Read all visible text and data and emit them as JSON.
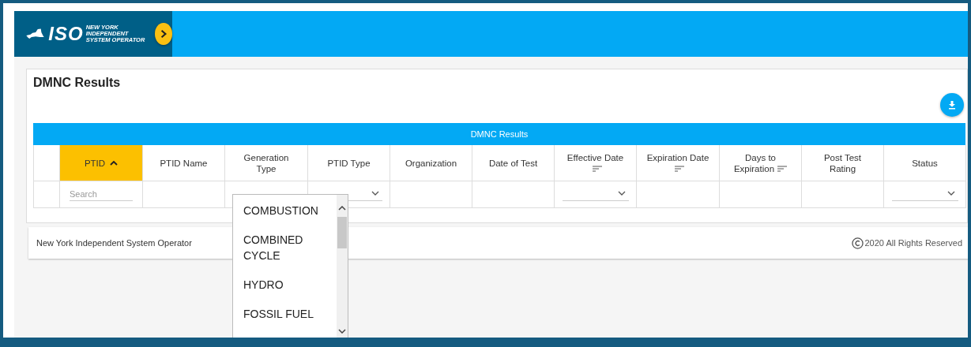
{
  "header": {
    "logo_mark": "ISO",
    "logo_lines": [
      "NEW YORK",
      "INDEPENDENT",
      "SYSTEM OPERATOR"
    ]
  },
  "page": {
    "title": "DMNC Results"
  },
  "table": {
    "caption": "DMNC Results",
    "columns": [
      {
        "selected": false,
        "sort_ascending": false,
        "sort_menu": false,
        "dropdown_filter": false
      },
      {
        "label": "PTID",
        "selected": true,
        "sort_ascending": true,
        "sort_menu": false,
        "dropdown_filter": false,
        "search": {
          "placeholder": "Search"
        }
      },
      {
        "label": "PTID Name",
        "selected": false,
        "sort_ascending": false,
        "sort_menu": false,
        "dropdown_filter": false
      },
      {
        "label": "Generation Type",
        "selected": false,
        "sort_ascending": false,
        "sort_menu": false,
        "dropdown_filter": false
      },
      {
        "label": "PTID Type",
        "selected": false,
        "sort_ascending": false,
        "sort_menu": false,
        "dropdown_filter": true
      },
      {
        "label": "Organization",
        "selected": false,
        "sort_ascending": false,
        "sort_menu": false,
        "dropdown_filter": false
      },
      {
        "label": "Date of Test",
        "selected": false,
        "sort_ascending": false,
        "sort_menu": false,
        "dropdown_filter": false
      },
      {
        "label": "Effective Date",
        "selected": false,
        "sort_ascending": false,
        "sort_menu": true,
        "dropdown_filter": true
      },
      {
        "label": "Expiration Date",
        "selected": false,
        "sort_ascending": false,
        "sort_menu": true,
        "dropdown_filter": false
      },
      {
        "label": "Days to Expiration",
        "selected": false,
        "sort_ascending": false,
        "sort_menu": true,
        "dropdown_filter": false
      },
      {
        "label": "Post Test Rating",
        "selected": false,
        "sort_ascending": false,
        "sort_menu": false,
        "dropdown_filter": false
      },
      {
        "label": "Status",
        "selected": false,
        "sort_ascending": false,
        "sort_menu": false,
        "dropdown_filter": true
      }
    ]
  },
  "dropdown": {
    "options": [
      "COMBUSTION",
      "COMBINED CYCLE",
      "HYDRO",
      "FOSSIL FUEL"
    ]
  },
  "footer": {
    "organization": "New York Independent System Operator",
    "copyright": "2020 All Rights Reserved"
  }
}
